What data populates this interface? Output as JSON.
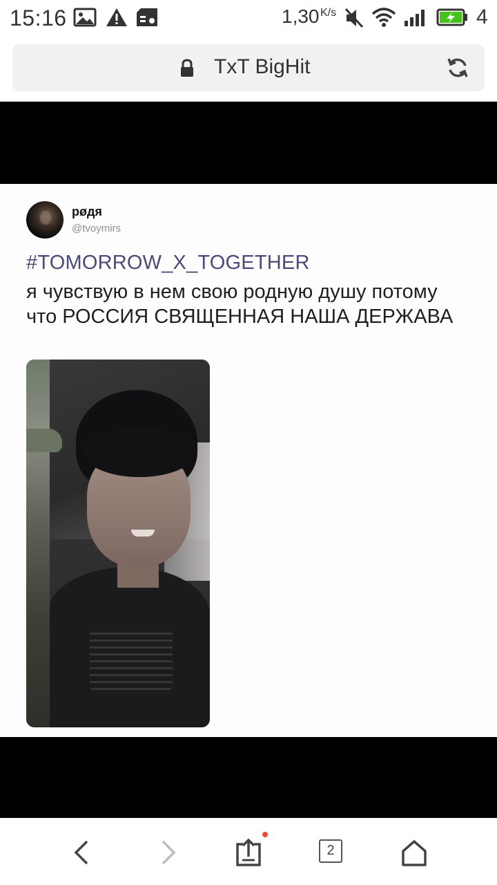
{
  "status_bar": {
    "time": "15:16",
    "speed": "1,30",
    "speed_unit": "K/s",
    "battery_number": "4",
    "icons": [
      "image-icon",
      "warning-icon",
      "sim-card-icon",
      "mute-icon",
      "wifi-icon",
      "signal-icon",
      "battery-charging-icon"
    ]
  },
  "address_bar": {
    "title": "TxT BigHit",
    "lock_icon": "lock-icon",
    "reload_icon": "reload-icon"
  },
  "tweet": {
    "display_name": "pøдя",
    "handle": "@tvoymirs",
    "hashtag": "#TOMORROW_X_TOGETHER",
    "text": "я чувствую в нем свою родную душу потому что РОССИЯ СВЯЩЕННАЯ НАША ДЕРЖАВА"
  },
  "bottom_nav": {
    "tab_count": "2",
    "icons": [
      "back-icon",
      "forward-icon",
      "share-icon",
      "tabs-icon",
      "home-icon"
    ]
  },
  "colors": {
    "hashtag": "#4a4a78",
    "notification_dot": "#f04a3a",
    "battery": "#43c31c"
  }
}
